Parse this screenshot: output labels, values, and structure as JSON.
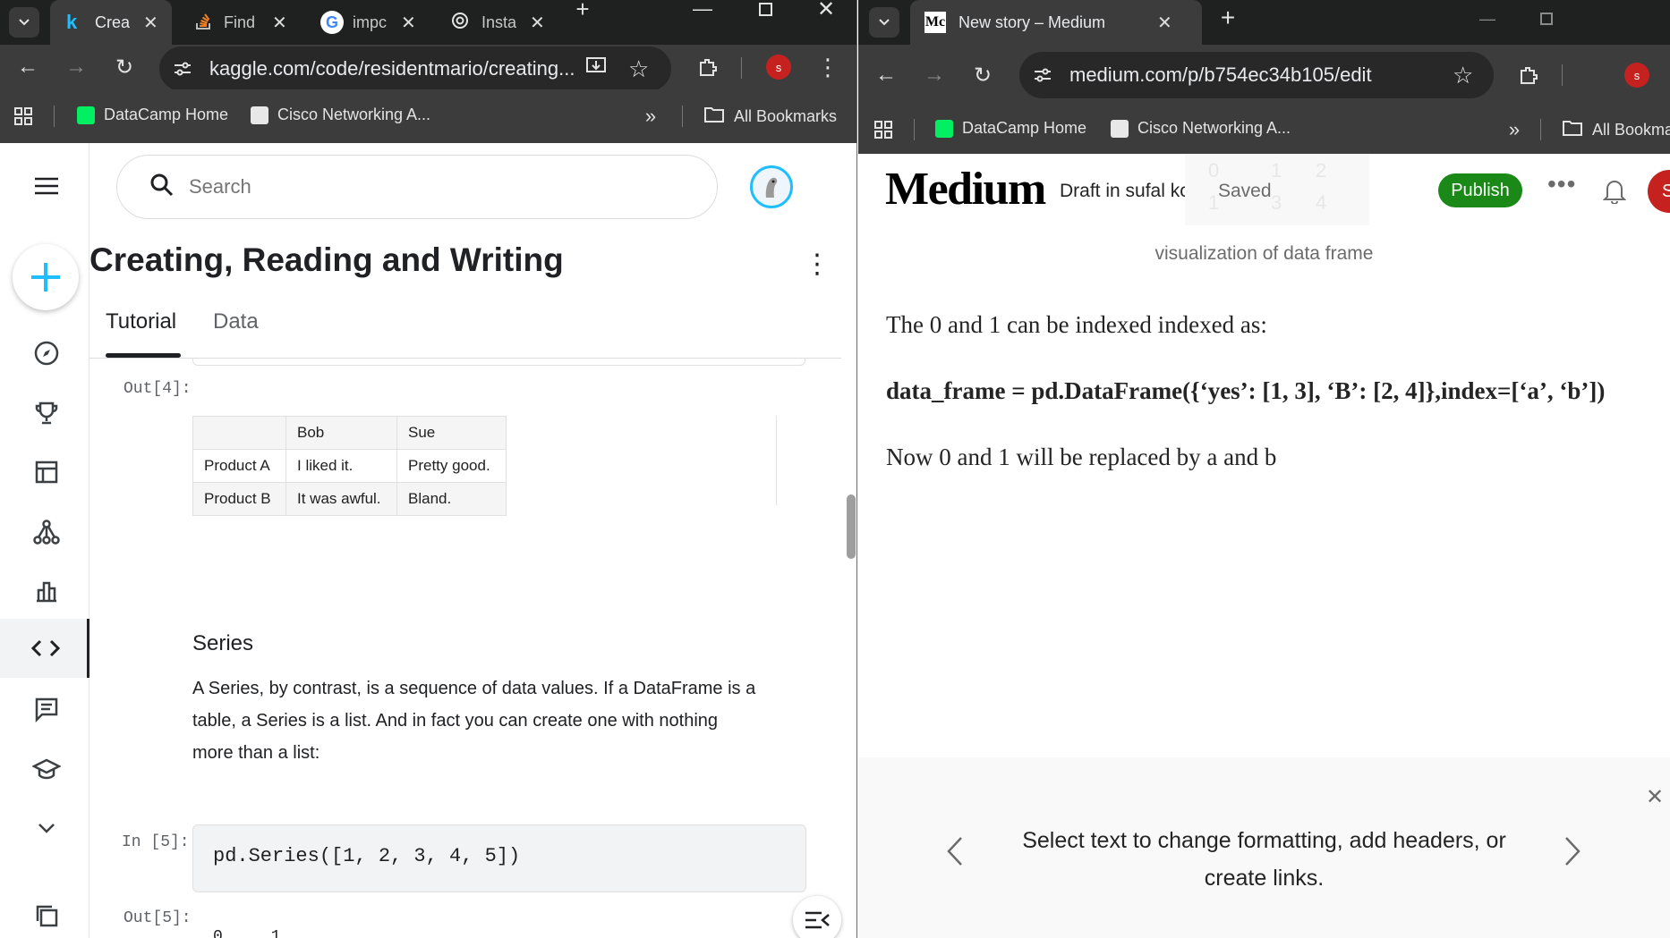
{
  "left": {
    "tabs": [
      {
        "label": "Crea",
        "icon": "kaggle-k-icon"
      },
      {
        "label": "Find",
        "icon": "stackoverflow-icon"
      },
      {
        "label": "impc",
        "icon": "google-icon"
      },
      {
        "label": "Insta",
        "icon": "openai-icon"
      }
    ],
    "url": "kaggle.com/code/residentmario/creating...",
    "avatar_letter": "s",
    "bookmarks": [
      "DataCamp Home",
      "Cisco Networking A...",
      "All Bookmarks"
    ],
    "kaggle": {
      "search_placeholder": "Search",
      "title": "Creating, Reading and Writing",
      "tabs": [
        "Tutorial",
        "Data"
      ],
      "out4_label": "Out[4]:",
      "table": {
        "columns": [
          "",
          "Bob",
          "Sue"
        ],
        "rows": [
          [
            "Product A",
            "I liked it.",
            "Pretty good."
          ],
          [
            "Product B",
            "It was awful.",
            "Bland."
          ]
        ]
      },
      "series_heading": "Series",
      "series_para": [
        "A Series, by contrast, is a sequence of data values. If a DataFrame is a",
        "table, a Series is a list. And in fact you can create one with nothing",
        "more than a list:"
      ],
      "in5_label": "In [5]:",
      "in5_code": "pd.Series([1, 2, 3, 4, 5])",
      "out5_label": "Out[5]:",
      "out5_partial": "0     1"
    }
  },
  "right": {
    "tab_title": "New story – Medium",
    "tab_favicon": "Mc",
    "url": "medium.com/p/b754ec34b105/edit",
    "avatar_letter": "s",
    "bookmarks": [
      "DataCamp Home",
      "Cisco Networking A...",
      "All Bookma"
    ],
    "medium": {
      "logo": "Medium",
      "draft": "Draft in sufal kc",
      "saved": "Saved",
      "publish": "Publish",
      "caption": "visualization of data frame",
      "p1": "The 0 and 1 can be indexed indexed as:",
      "p2": "data_frame = pd.DataFrame({‘yes’: [1, 3], ‘B’: [2, 4]},index=[‘a’, ‘b’])",
      "p3": "Now 0 and 1 will be replaced by a and b",
      "hint_line1": "Select text to change formatting, add headers, or",
      "hint_line2": "create links.",
      "ghost_digits": [
        "0",
        "1",
        "2",
        "1",
        "3",
        "4"
      ],
      "avatar_letter": "S"
    }
  }
}
